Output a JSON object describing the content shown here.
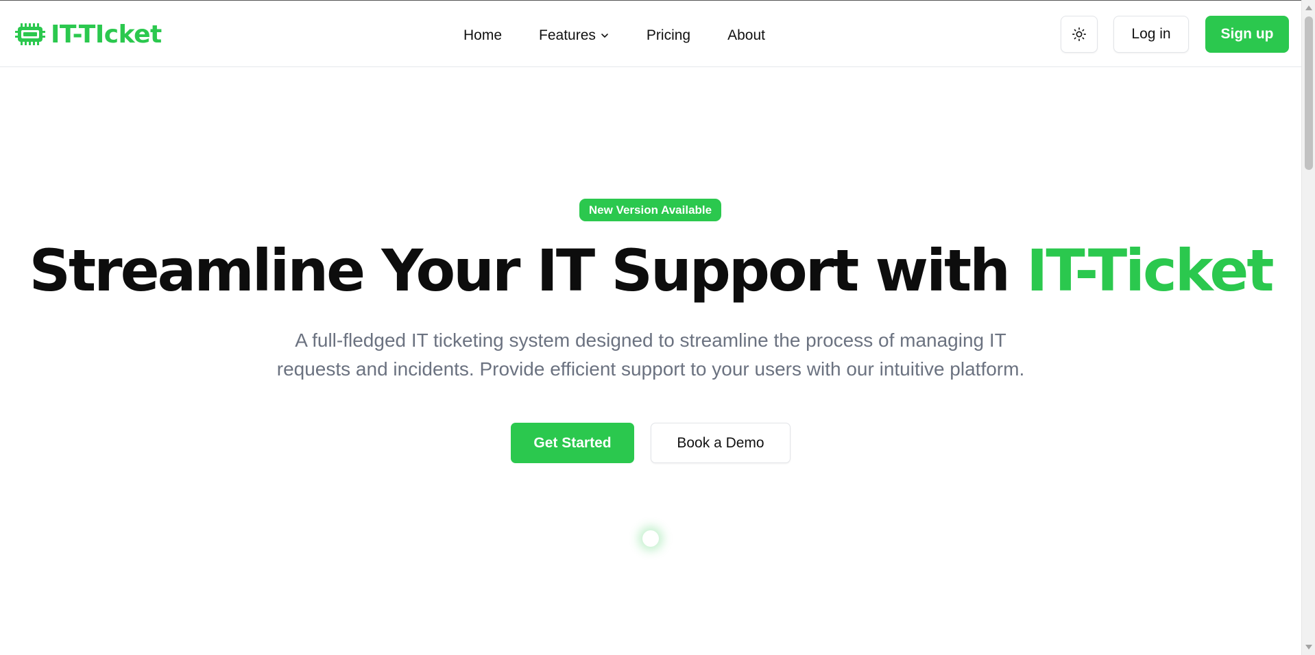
{
  "brand": {
    "name": "IT-TIcket",
    "logo_icon": "chip-icon",
    "color": "#2bc84e"
  },
  "nav": {
    "items": [
      {
        "label": "Home"
      },
      {
        "label": "Features",
        "has_dropdown": true
      },
      {
        "label": "Pricing"
      },
      {
        "label": "About"
      }
    ],
    "theme_toggle_icon": "sun-icon",
    "login_label": "Log in",
    "signup_label": "Sign up"
  },
  "hero": {
    "badge": "New Version Available",
    "title_main": "Streamline Your IT Support with ",
    "title_accent": "IT-Ticket",
    "subtitle_line1": "A full-fledged IT ticketing system designed to streamline the process of managing IT",
    "subtitle_line2": "requests and incidents. Provide efficient support to your users with our intuitive platform.",
    "primary_cta": "Get Started",
    "secondary_cta": "Book a Demo"
  },
  "colors": {
    "accent": "#2bc84e",
    "text": "#0d0d0d",
    "muted": "#6b7280",
    "border": "#e2e4e8"
  }
}
